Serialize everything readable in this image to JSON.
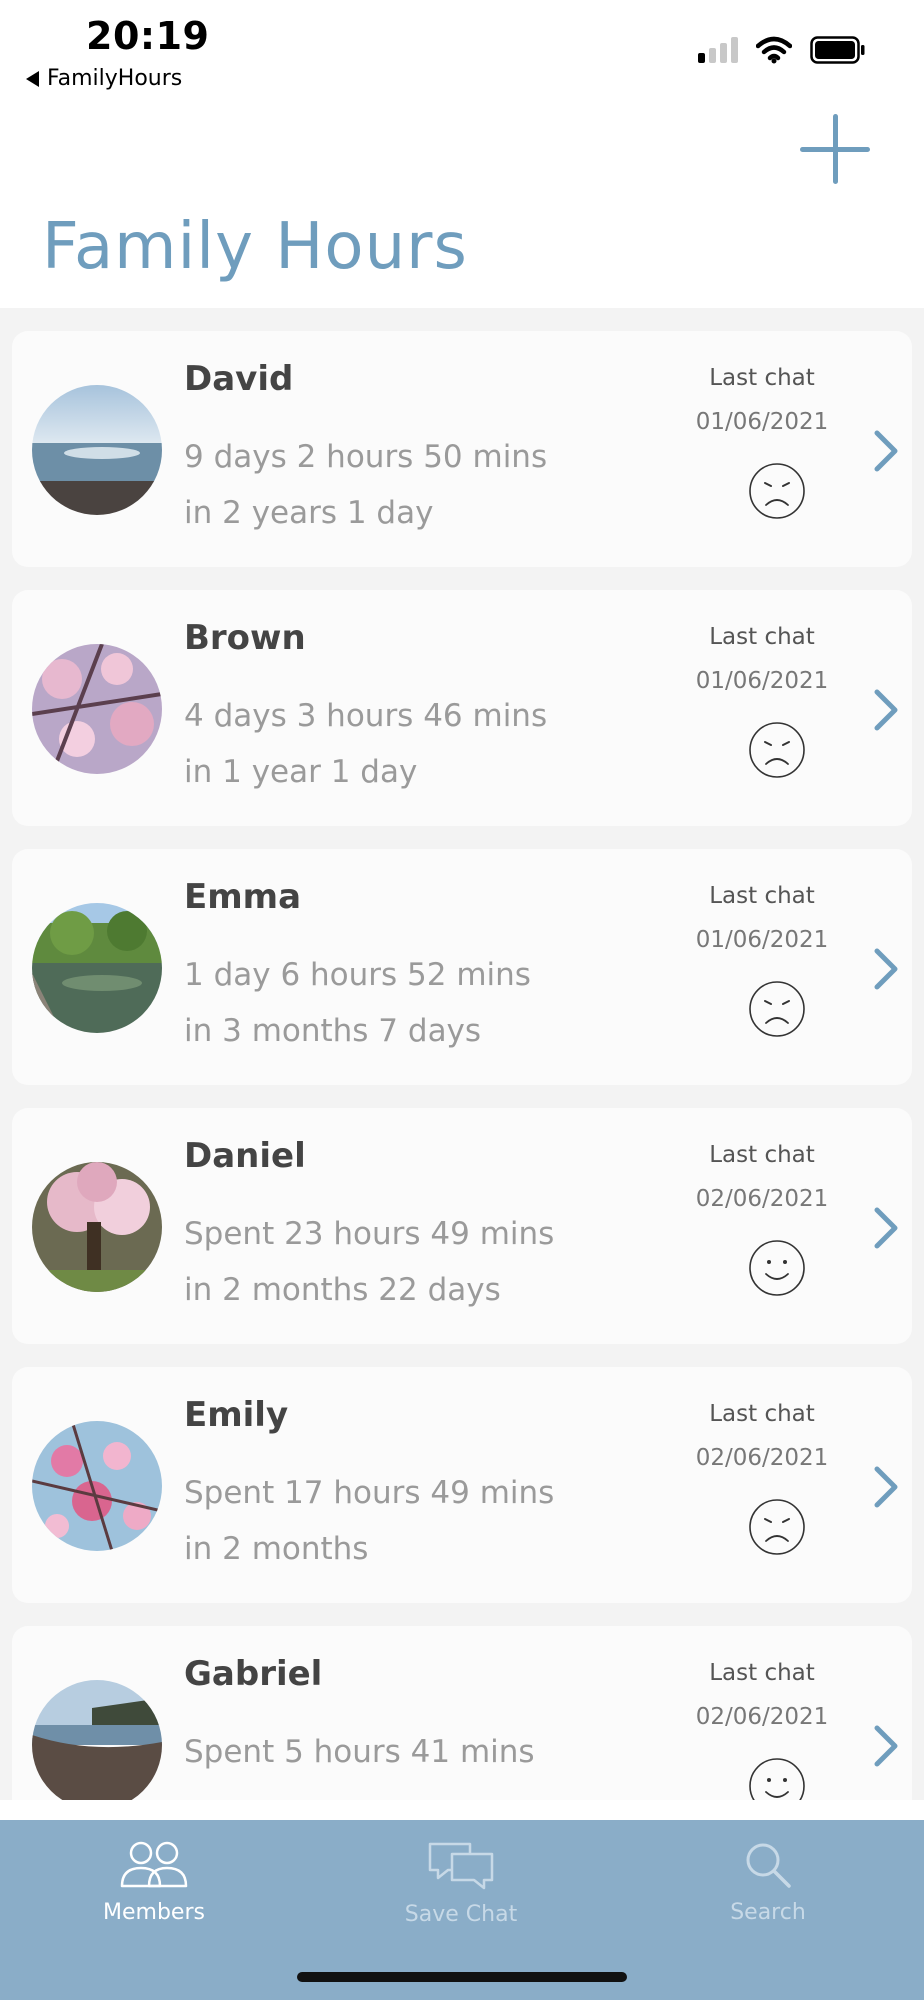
{
  "status_bar": {
    "time": "20:19",
    "back_app": "FamilyHours"
  },
  "header": {
    "title": "Family Hours",
    "add_icon": "plus-icon"
  },
  "colors": {
    "accent": "#6f9dbd",
    "tab_bar": "#8aadc8",
    "card_bg": "#fbfbfb"
  },
  "members": [
    {
      "name": "David",
      "spent": "9 days 2 hours 50 mins",
      "since": "in 2 years 1 day",
      "last_chat_label": "Last chat",
      "last_chat_date": "01/06/2021",
      "mood": "sad-face-icon",
      "avatar": "sea-photo"
    },
    {
      "name": "Brown",
      "spent": "4 days 3 hours 46 mins",
      "since": "in 1 year 1 day",
      "last_chat_label": "Last chat",
      "last_chat_date": "01/06/2021",
      "mood": "sad-face-icon",
      "avatar": "blossom-photo"
    },
    {
      "name": "Emma",
      "spent": "1 day 6 hours 52 mins",
      "since": "in 3 months 7 days",
      "last_chat_label": "Last chat",
      "last_chat_date": "01/06/2021",
      "mood": "sad-face-icon",
      "avatar": "river-photo"
    },
    {
      "name": "Daniel",
      "spent": "Spent 23 hours 49 mins",
      "since": "in 2 months 22 days",
      "last_chat_label": "Last chat",
      "last_chat_date": "02/06/2021",
      "mood": "happy-face-icon",
      "avatar": "magnolia-tree-photo"
    },
    {
      "name": "Emily",
      "spent": "Spent 17 hours 49 mins",
      "since": "in 2 months",
      "last_chat_label": "Last chat",
      "last_chat_date": "02/06/2021",
      "mood": "sad-face-icon",
      "avatar": "magnolia-flower-photo"
    },
    {
      "name": "Gabriel",
      "spent": "Spent 5 hours 41 mins",
      "since": "",
      "last_chat_label": "Last chat",
      "last_chat_date": "02/06/2021",
      "mood": "happy-face-icon",
      "avatar": "beach-photo"
    }
  ],
  "tabs": [
    {
      "label": "Members",
      "icon": "members-icon",
      "active": true
    },
    {
      "label": "Save Chat",
      "icon": "chat-bubbles-icon",
      "active": false
    },
    {
      "label": "Search",
      "icon": "search-icon",
      "active": false
    }
  ]
}
